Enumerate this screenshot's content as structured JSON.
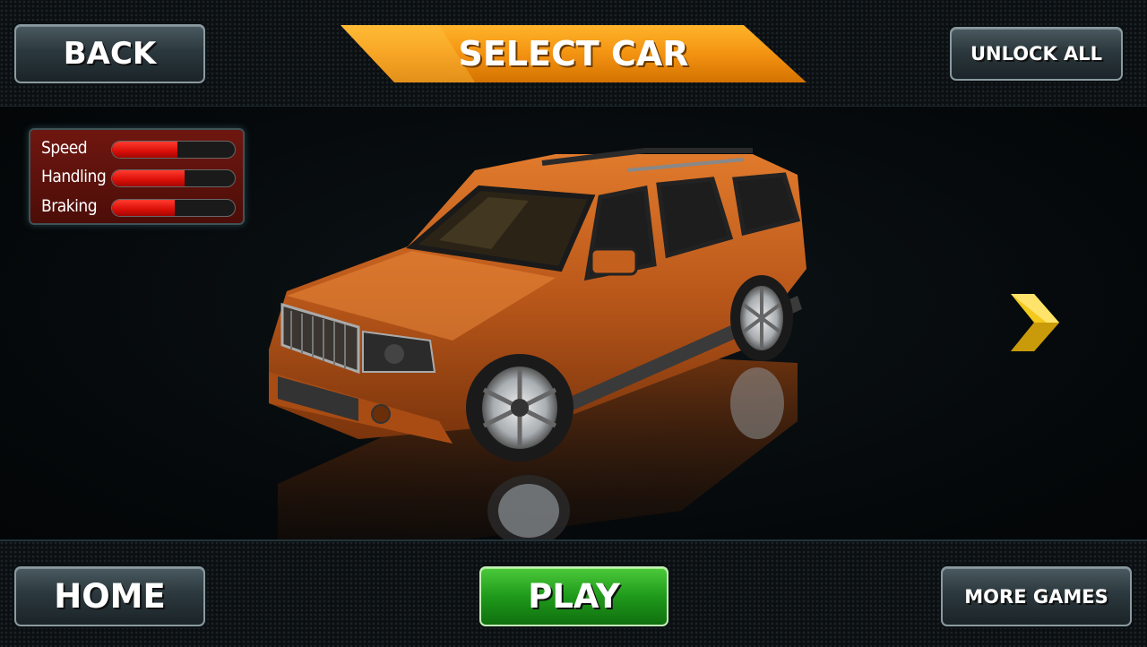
{
  "header": {
    "back_label": "BACK",
    "title": "SELECT CAR",
    "unlock_all_label": "UNLOCK ALL"
  },
  "stats": [
    {
      "label": "Speed",
      "value": 0.53
    },
    {
      "label": "Handling",
      "value": 0.59
    },
    {
      "label": "Braking",
      "value": 0.51
    }
  ],
  "footer": {
    "home_label": "HOME",
    "play_label": "PLAY",
    "more_games_label": "MORE GAMES"
  },
  "car": {
    "color": "#c8621c"
  },
  "colors": {
    "banner": "#f7a21a",
    "play_green": "#1f9a1b",
    "arrow_yellow": "#f2c91c",
    "stat_red": "#e0140b"
  },
  "icons": {
    "next": "chevron-right-icon"
  }
}
